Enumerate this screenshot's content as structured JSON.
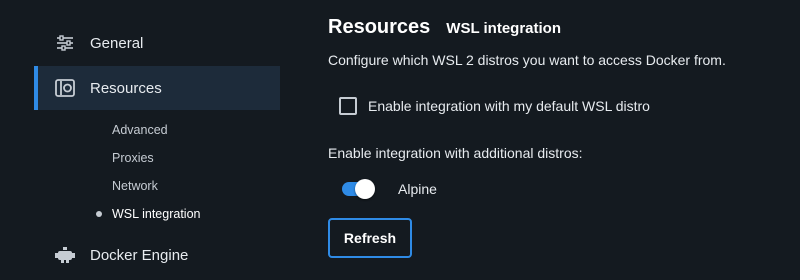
{
  "sidebar": {
    "items": [
      {
        "label": "General",
        "icon": "sliders-icon"
      },
      {
        "label": "Resources",
        "icon": "resources-icon",
        "active": true
      },
      {
        "label": "Docker Engine",
        "icon": "docker-engine-icon"
      }
    ],
    "resources_subitems": [
      {
        "label": "Advanced"
      },
      {
        "label": "Proxies"
      },
      {
        "label": "Network"
      },
      {
        "label": "WSL integration",
        "current": true
      }
    ]
  },
  "main": {
    "title": "Resources",
    "subtitle": "WSL integration",
    "description": "Configure which WSL 2 distros you want to access Docker from.",
    "default_distro_checkbox": {
      "label": "Enable integration with my default WSL distro",
      "checked": false
    },
    "additional_distros_label": "Enable integration with additional distros:",
    "distros": [
      {
        "name": "Alpine",
        "enabled": true
      }
    ],
    "refresh_button": "Refresh"
  },
  "colors": {
    "background": "#141a20",
    "accent": "#2f8be6",
    "active_nav_bg": "#1d2b3a"
  }
}
